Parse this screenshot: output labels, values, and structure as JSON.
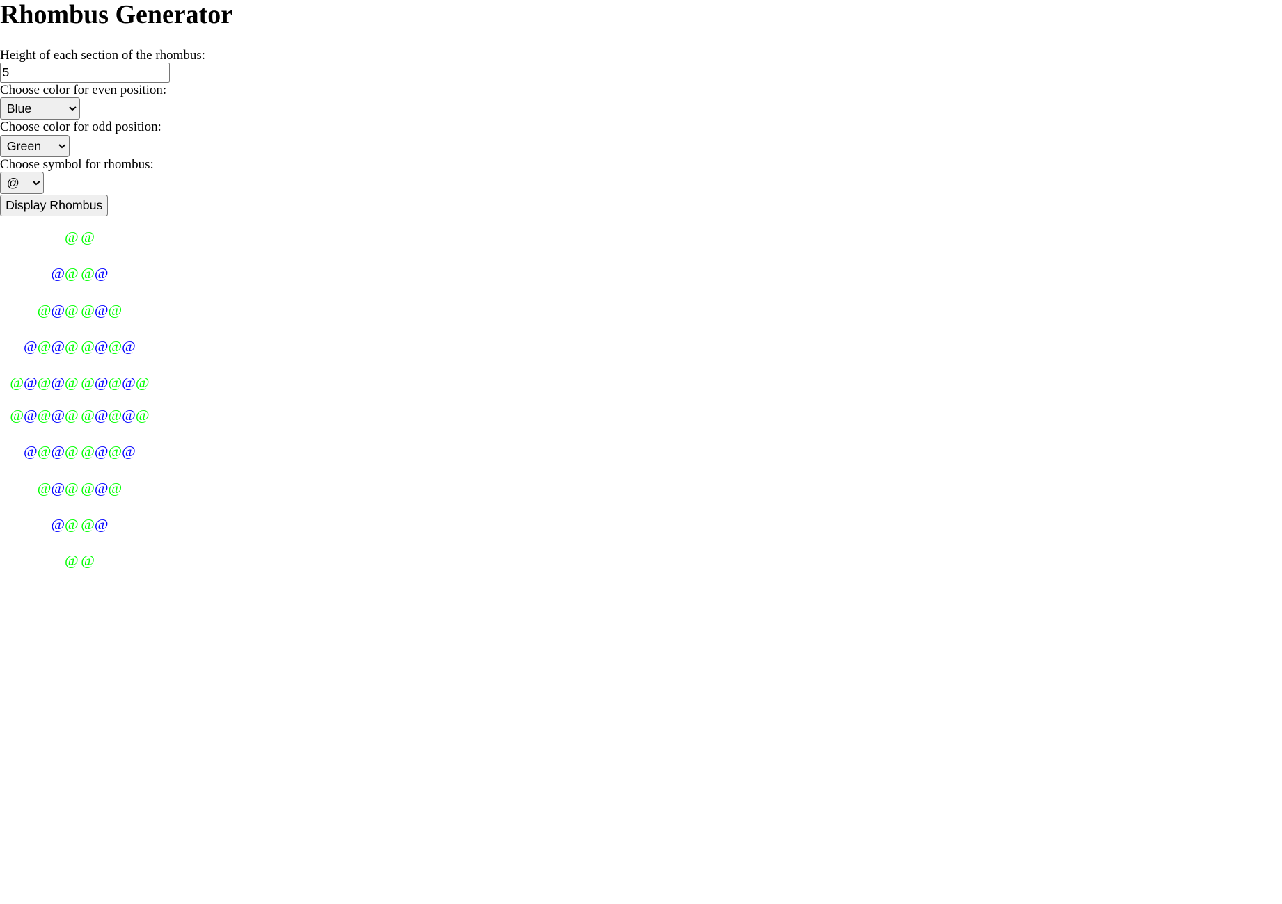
{
  "page": {
    "title": "Rhombus Generator"
  },
  "form": {
    "height_label": "Height of each section of the rhombus:",
    "height_value": "5",
    "even_label": "Choose color for even position:",
    "even_options": [
      "Blue"
    ],
    "even_selected": "Blue",
    "odd_label": "Choose color for odd position:",
    "odd_options": [
      "Green"
    ],
    "odd_selected": "Green",
    "symbol_label": "Choose symbol for rhombus:",
    "symbol_options": [
      "@"
    ],
    "symbol_selected": "@",
    "submit_label": "Display Rhombus"
  },
  "colors": {
    "blue": "#0000ff",
    "green": "#00ff00"
  },
  "rhombus": {
    "symbol": "@",
    "top": [
      {
        "left": "g",
        "right": "g"
      },
      {
        "left": "bg",
        "right": "gb"
      },
      {
        "left": "gbg",
        "right": "gbg"
      },
      {
        "left": "bgbg",
        "right": "gbgb"
      },
      {
        "left": "gbgbg",
        "right": "gbgbg"
      }
    ],
    "bottom": [
      {
        "left": "gbgbg",
        "right": "gbgbg"
      },
      {
        "left": "bgbg",
        "right": "gbgb"
      },
      {
        "left": "gbg",
        "right": "gbg"
      },
      {
        "left": "bg",
        "right": "gb"
      },
      {
        "left": "g",
        "right": "g"
      }
    ]
  }
}
